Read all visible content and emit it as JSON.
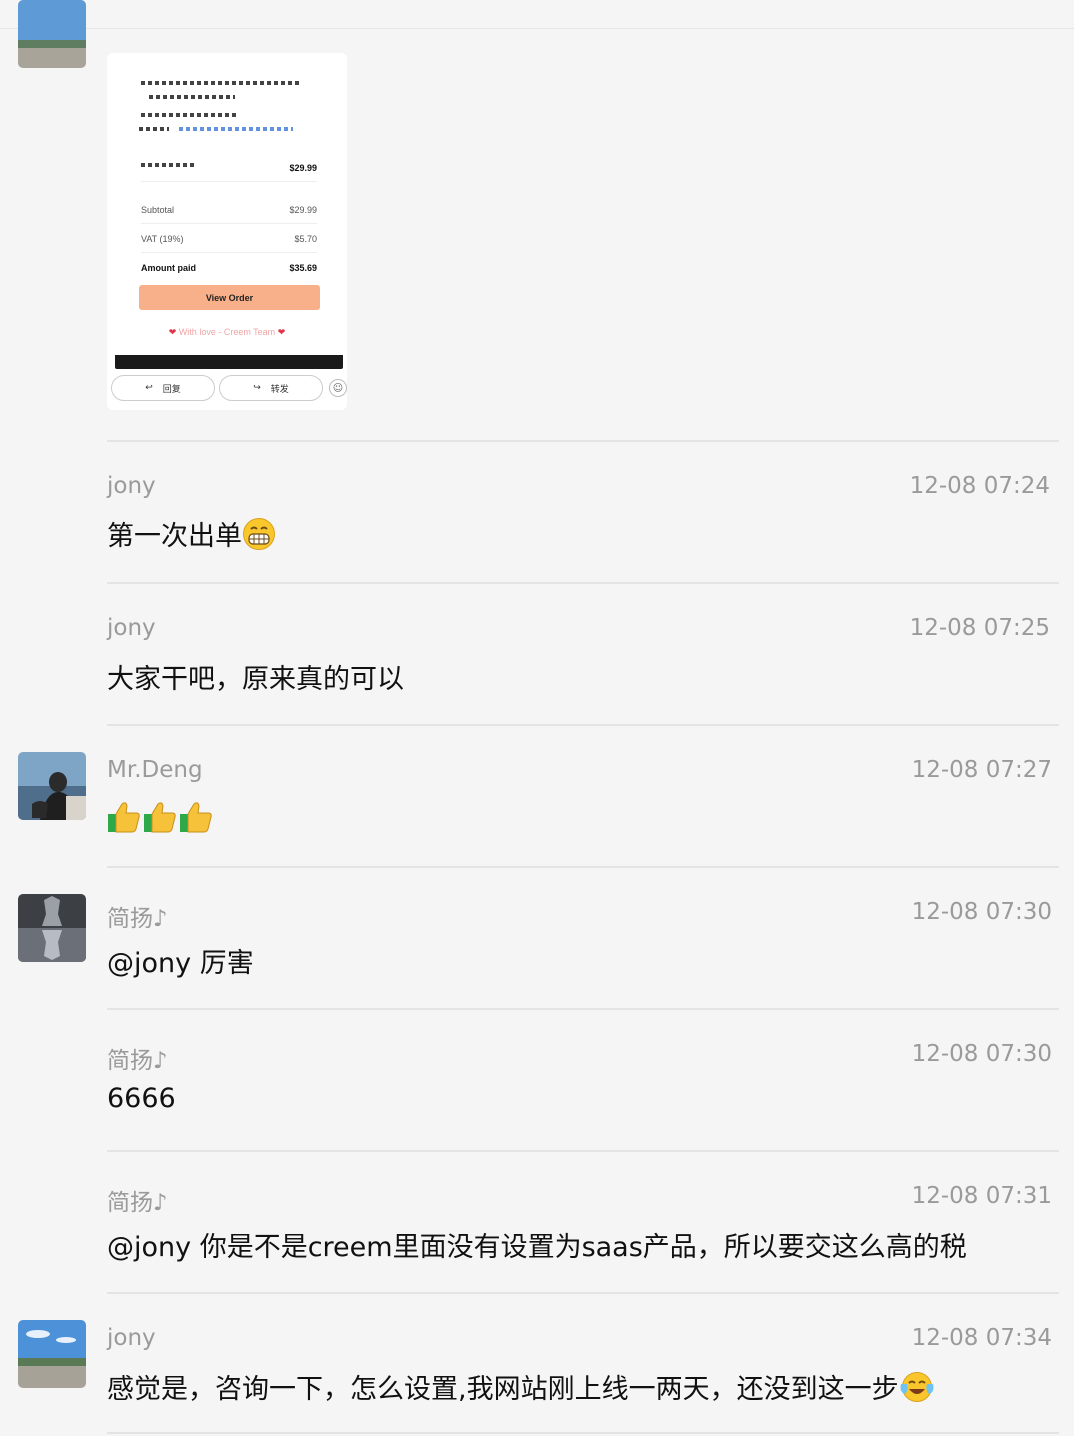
{
  "shot": {
    "item_price": "$29.99",
    "rows": [
      {
        "label": "Subtotal",
        "value": "$29.99"
      },
      {
        "label": "VAT (19%)",
        "value": "$5.70"
      },
      {
        "label": "Amount paid",
        "value": "$35.69"
      }
    ],
    "view_order": "View Order",
    "love": "With love - Creem Team",
    "reply": "回复",
    "forward": "转发"
  },
  "messages": [
    {
      "name": "jony",
      "time": "12-08 07:24",
      "text": "第一次出单",
      "emoji": "grin-face"
    },
    {
      "name": "jony",
      "time": "12-08 07:25",
      "text": "大家干吧，原来真的可以"
    },
    {
      "name": "Mr.Deng",
      "time": "12-08 07:27",
      "text": "",
      "emoji": "thumbs-up x3"
    },
    {
      "name": "简扬♪",
      "time": "12-08 07:30",
      "text": "@jony 厉害"
    },
    {
      "name": "简扬♪",
      "time": "12-08 07:30",
      "text": "6666"
    },
    {
      "name": "简扬♪",
      "time": "12-08 07:31",
      "text": "@jony 你是不是creem里面没有设置为saas产品，所以要交这么高的税"
    },
    {
      "name": "jony",
      "time": "12-08 07:34",
      "text": "感觉是，咨询一下，怎么设置,我网站刚上线一两天，还没到这一步",
      "emoji": "tears-of-joy-face"
    }
  ],
  "colors": {
    "background": "#f5f5f5",
    "meta": "#9a9a9a",
    "text": "#111111",
    "button": "#f8b08a"
  }
}
